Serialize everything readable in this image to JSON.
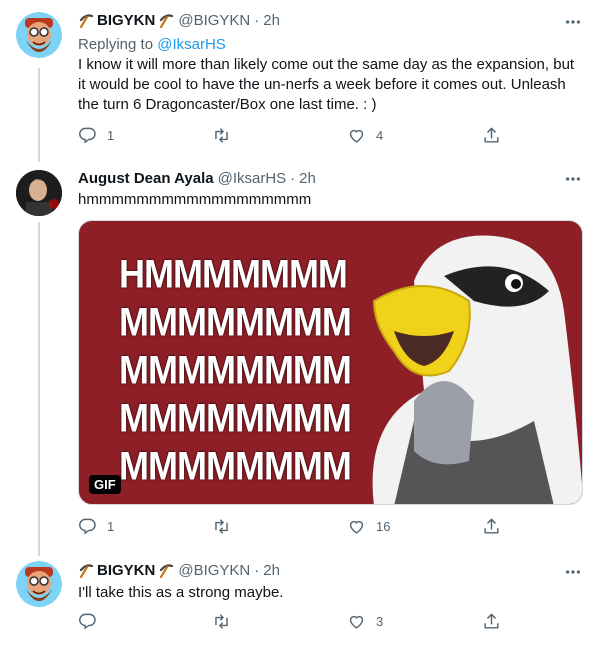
{
  "tweets": [
    {
      "name": "BIGYKN",
      "handle": "@BIGYKN",
      "time": "2h",
      "replying_prefix": "Replying to",
      "replying_to": "@IksarHS",
      "text": "I know it will more than likely come out the same day as the expansion, but it would be cool to have the un-nerfs a week before it comes out. Unleash the turn 6 Dragoncaster/Box one last time.  : )",
      "replies": "1",
      "retweets": "",
      "likes": "4"
    },
    {
      "name": "August Dean Ayala",
      "handle": "@IksarHS",
      "time": "2h",
      "text": "hmmmmmmmmmmmmmmmmmm",
      "media_lines": [
        "HMMMMMMM",
        "MMMMMMMM",
        "MMMMMMMM",
        "MMMMMMMM",
        "MMMMMMMM"
      ],
      "gif_badge": "GIF",
      "replies": "1",
      "retweets": "",
      "likes": "16"
    },
    {
      "name": "BIGYKN",
      "handle": "@BIGYKN",
      "time": "2h",
      "text": "I'll take this as a strong maybe.",
      "replies": "",
      "retweets": "",
      "likes": "3"
    }
  ],
  "colors": {
    "accent": "#1d9bf0",
    "muted": "#536471",
    "media_bg": "#8e1f27"
  },
  "icons": [
    "pickaxe-icon",
    "more-icon",
    "reply-icon",
    "retweet-icon",
    "like-icon",
    "share-icon"
  ]
}
